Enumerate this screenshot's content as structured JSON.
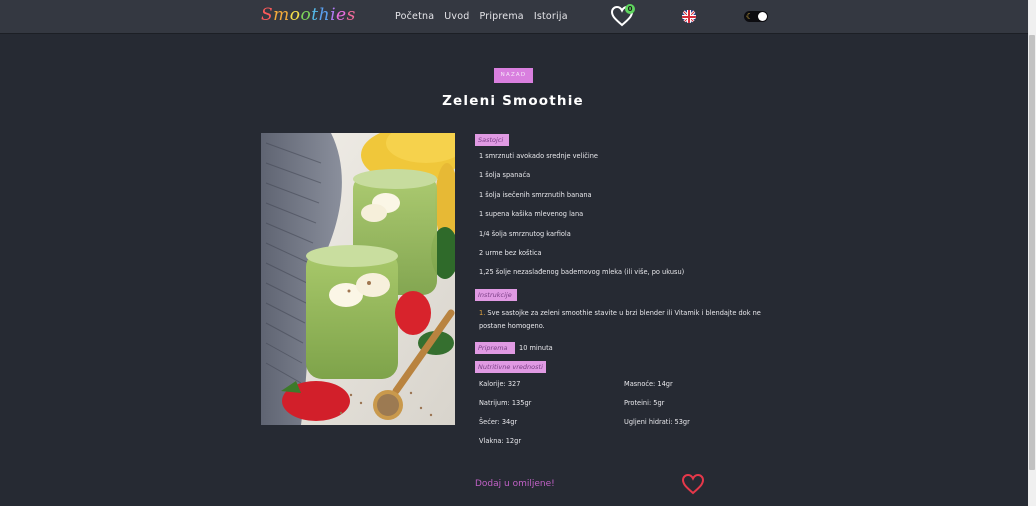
{
  "navbar": {
    "logo_letters": [
      "S",
      "m",
      "o",
      "o",
      "t",
      "h",
      "i",
      "e",
      "s"
    ],
    "logo_colors": [
      "#ff5a5a",
      "#f2a93b",
      "#f5e04a",
      "#7cd35a",
      "#55b9e8",
      "#5aa0f0",
      "#b07af5",
      "#e86ee0",
      "#f06b9b"
    ],
    "links": [
      "Početna",
      "Uvod",
      "Priprema",
      "Istorija"
    ],
    "favorites_count": "0",
    "language": "english-flag-icon",
    "theme": "dark"
  },
  "back_label": "NAZAD",
  "title": "Zeleni Smoothie",
  "ingredients_label": "Sastojci",
  "ingredients": [
    "1 smrznuti avokado srednje veličine",
    "1 šolja spanaća",
    "1 šolja isečenih smrznutih banana",
    "1 supena kašika mlevenog lana",
    "1/4 šolja smrznutog karfiola",
    "2 urme bez koštica",
    "1,25 šolje nezaslađenog bademovog mleka (ili više, po ukusu)"
  ],
  "instructions_label": "Instrukcije",
  "instructions": [
    {
      "num": "1.",
      "text": "Sve sastojke za zeleni smoothie stavite u brzi blender ili Vitamik i blendajte dok ne postane homogeno."
    }
  ],
  "prep_label": "Priprema",
  "prep_value": "10 minuta",
  "nutrition_label": "Nutritivne vrednosti",
  "nutrition_left": [
    "Kalorije: 327",
    "Natrijum: 135gr",
    "Šećer: 34gr",
    "Vlakna: 12gr"
  ],
  "nutrition_right": [
    "Masnoće: 14gr",
    "Proteini: 5gr",
    "Ugljeni hidrati: 53gr"
  ],
  "add_favorite": "Dodaj u omiljene!",
  "colors": {
    "accent": "#d97fdf",
    "background": "#262a33",
    "heart": "#e5384a"
  }
}
